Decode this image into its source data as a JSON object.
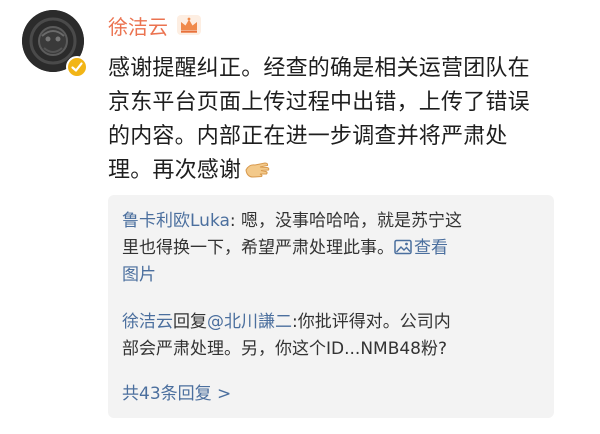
{
  "post": {
    "username": "徐洁云",
    "lines": [
      "感谢提醒纠正。经查的确是相关运营团队在",
      "京东平台页面上传过程中出错，上传了错误",
      "的内容。内部正在进一步调查并将严肃处",
      "理。再次感谢"
    ]
  },
  "comments": [
    {
      "author": "鲁卡利欧Luka",
      "line1": ": 嗯，没事哈哈哈，就是苏宁这",
      "line2": "里也得换一下，希望严肃处理此事。",
      "view_pic_1": "查看",
      "view_pic_2": "图片"
    },
    {
      "author": "徐洁云",
      "reply_word": "回复",
      "mention": "@北川謙二",
      "line1_text": ":你批评得对。公司内",
      "line2": "部会严肃处理。另，你这个ID...NMB48粉?"
    }
  ],
  "reply_count_label": "共43条回复 >",
  "colors": {
    "username": "#eb7350",
    "link": "#4b6f9e",
    "badge": "#f2b516",
    "comment_bg": "#f3f3f3"
  },
  "icons": [
    "crown-icon",
    "verified-icon",
    "clap-icon",
    "picture-icon"
  ]
}
